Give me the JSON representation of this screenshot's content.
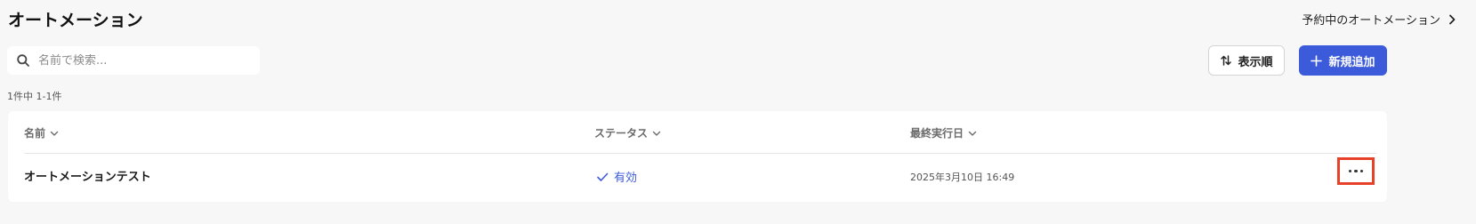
{
  "page": {
    "title": "オートメーション"
  },
  "header": {
    "scheduled_link_label": "予約中のオートメーション"
  },
  "search": {
    "placeholder": "名前で検索...",
    "value": ""
  },
  "toolbar": {
    "sort_label": "表示順",
    "add_label": "新規追加"
  },
  "result_count": "1件中 1-1件",
  "table": {
    "columns": [
      {
        "label": "名前"
      },
      {
        "label": "ステータス"
      },
      {
        "label": "最終実行日"
      }
    ],
    "rows": [
      {
        "name": "オートメーションテスト",
        "status": "有効",
        "last_run": "2025年3月10日 16:49"
      }
    ]
  },
  "colors": {
    "accent": "#3c5bdb",
    "highlight_border": "#e8412a",
    "background": "#f7f7f7"
  },
  "icons": {
    "search": "search-icon",
    "sort": "sort-arrows-icon",
    "add": "plus-icon",
    "link": "chevron-right-icon",
    "column_sort": "chevron-down-icon",
    "status": "check-icon",
    "row_menu": "more-horizontal-icon"
  }
}
